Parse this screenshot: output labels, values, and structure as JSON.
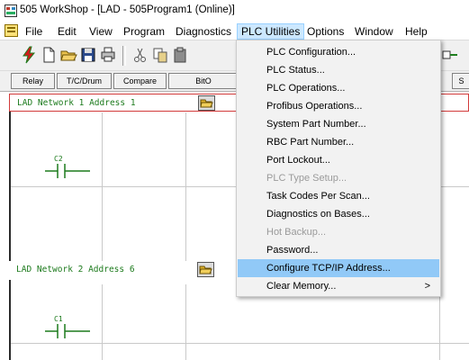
{
  "window": {
    "title": "505 WorkShop - [LAD - 505Program1 (Online)]"
  },
  "menubar": {
    "items": [
      "File",
      "Edit",
      "View",
      "Program",
      "Diagnostics",
      "PLC Utilities",
      "Options",
      "Window",
      "Help"
    ],
    "active": "PLC Utilities"
  },
  "toolbar": {
    "icons": [
      "lightning-icon",
      "new-document-icon",
      "open-folder-icon",
      "save-icon",
      "print-icon",
      "cut-icon",
      "copy-icon",
      "paste-icon"
    ]
  },
  "tabs": [
    "Relay",
    "T/C/Drum",
    "Compare",
    "BitO",
    "S"
  ],
  "networks": [
    {
      "label": "LAD Network 1 Address  1",
      "contact": "C2"
    },
    {
      "label": "LAD Network 2 Address  6",
      "contact": "C1"
    }
  ],
  "plc_utilities_menu": {
    "items": [
      {
        "label": "PLC Configuration...",
        "enabled": true
      },
      {
        "label": "PLC Status...",
        "enabled": true
      },
      {
        "label": "PLC Operations...",
        "enabled": true
      },
      {
        "label": "Profibus Operations...",
        "enabled": true
      },
      {
        "label": "System Part Number...",
        "enabled": true
      },
      {
        "label": "RBC Part Number...",
        "enabled": true
      },
      {
        "label": "Port Lockout...",
        "enabled": true
      },
      {
        "label": "PLC Type Setup...",
        "enabled": false
      },
      {
        "label": "Task Codes Per Scan...",
        "enabled": true
      },
      {
        "label": "Diagnostics on Bases...",
        "enabled": true
      },
      {
        "label": "Hot Backup...",
        "enabled": false
      },
      {
        "label": "Password...",
        "enabled": true
      },
      {
        "label": "Configure TCP/IP Address...",
        "enabled": true,
        "highlighted": true
      },
      {
        "label": "Clear Memory...",
        "enabled": true,
        "submenu_arrow": ">"
      }
    ]
  }
}
